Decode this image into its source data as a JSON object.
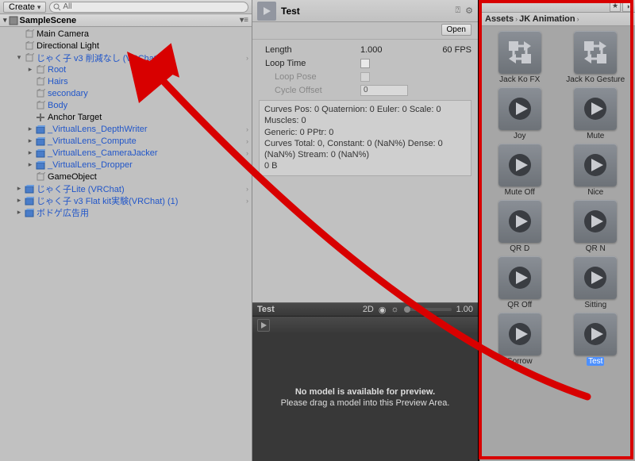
{
  "hierarchy": {
    "create_label": "Create",
    "search_placeholder": "All",
    "scene_name": "SampleScene",
    "items": [
      {
        "depth": 1,
        "fold": "",
        "label": "Main Camera",
        "cls": "",
        "icon": "cube"
      },
      {
        "depth": 1,
        "fold": "",
        "label": "Directional Light",
        "cls": "",
        "icon": "cube"
      },
      {
        "depth": 1,
        "fold": "open",
        "label": "じゃく子 v3 削減なし (VRChat)",
        "cls": "blue",
        "icon": "cube",
        "more": true
      },
      {
        "depth": 2,
        "fold": "closed",
        "label": "Root",
        "cls": "blue",
        "icon": "cube"
      },
      {
        "depth": 2,
        "fold": "",
        "label": "Hairs",
        "cls": "blue",
        "icon": "cube"
      },
      {
        "depth": 2,
        "fold": "",
        "label": "secondary",
        "cls": "blue",
        "icon": "cube"
      },
      {
        "depth": 2,
        "fold": "",
        "label": "Body",
        "cls": "blue",
        "icon": "cube"
      },
      {
        "depth": 2,
        "fold": "",
        "label": "Anchor Target",
        "cls": "",
        "icon": "plus"
      },
      {
        "depth": 2,
        "fold": "closed",
        "label": "_VirtualLens_DepthWriter",
        "cls": "blue",
        "icon": "prefab",
        "more": true
      },
      {
        "depth": 2,
        "fold": "closed",
        "label": "_VirtualLens_Compute",
        "cls": "blue",
        "icon": "prefab",
        "more": true
      },
      {
        "depth": 2,
        "fold": "closed",
        "label": "_VirtualLens_CameraJacker",
        "cls": "blue",
        "icon": "prefab",
        "more": true
      },
      {
        "depth": 2,
        "fold": "closed",
        "label": "_VirtualLens_Dropper",
        "cls": "blue",
        "icon": "prefab",
        "more": true
      },
      {
        "depth": 2,
        "fold": "",
        "label": "GameObject",
        "cls": "",
        "icon": "cube"
      },
      {
        "depth": 1,
        "fold": "closed",
        "label": "じゃく子Lite (VRChat)",
        "cls": "blue",
        "icon": "prefab",
        "more": true
      },
      {
        "depth": 1,
        "fold": "closed",
        "label": "じゃく子 v3 Flat kit実験(VRChat) (1)",
        "cls": "blue",
        "icon": "prefab",
        "more": true
      },
      {
        "depth": 1,
        "fold": "closed",
        "label": "ボドゲ広告用",
        "cls": "blue",
        "icon": "prefab"
      }
    ]
  },
  "inspector": {
    "name": "Test",
    "open_label": "Open",
    "length_label": "Length",
    "length_value": "1.000",
    "fps": "60 FPS",
    "loop_time_label": "Loop Time",
    "loop_pose_label": "Loop Pose",
    "cycle_offset_label": "Cycle Offset",
    "cycle_offset_value": "0",
    "curves_l1": "Curves Pos: 0 Quaternion: 0 Euler: 0 Scale: 0 Muscles: 0",
    "curves_l2": "Generic: 0 PPtr: 0",
    "curves_l3": "Curves Total: 0, Constant: 0 (NaN%) Dense: 0 (NaN%) Stream: 0 (NaN%)",
    "curves_l4": "0 B"
  },
  "preview": {
    "title": "Test",
    "mode_2d": "2D",
    "speed": "1.00",
    "msg1": "No model is available for preview.",
    "msg2": "Please drag a model into this Preview Area."
  },
  "project": {
    "bc1": "Assets",
    "bc2": "JK Animation",
    "assets": [
      {
        "label": "Jack Ko FX",
        "type": "controller"
      },
      {
        "label": "Jack Ko Gesture",
        "type": "controller"
      },
      {
        "label": "Joy",
        "type": "clip"
      },
      {
        "label": "Mute",
        "type": "clip"
      },
      {
        "label": "Mute Off",
        "type": "clip"
      },
      {
        "label": "Nice",
        "type": "clip"
      },
      {
        "label": "QR D",
        "type": "clip"
      },
      {
        "label": "QR N",
        "type": "clip"
      },
      {
        "label": "QR Off",
        "type": "clip"
      },
      {
        "label": "Sitting",
        "type": "clip"
      },
      {
        "label": "Sorrow",
        "type": "clip"
      },
      {
        "label": "Test",
        "type": "clip",
        "selected": true
      }
    ]
  }
}
